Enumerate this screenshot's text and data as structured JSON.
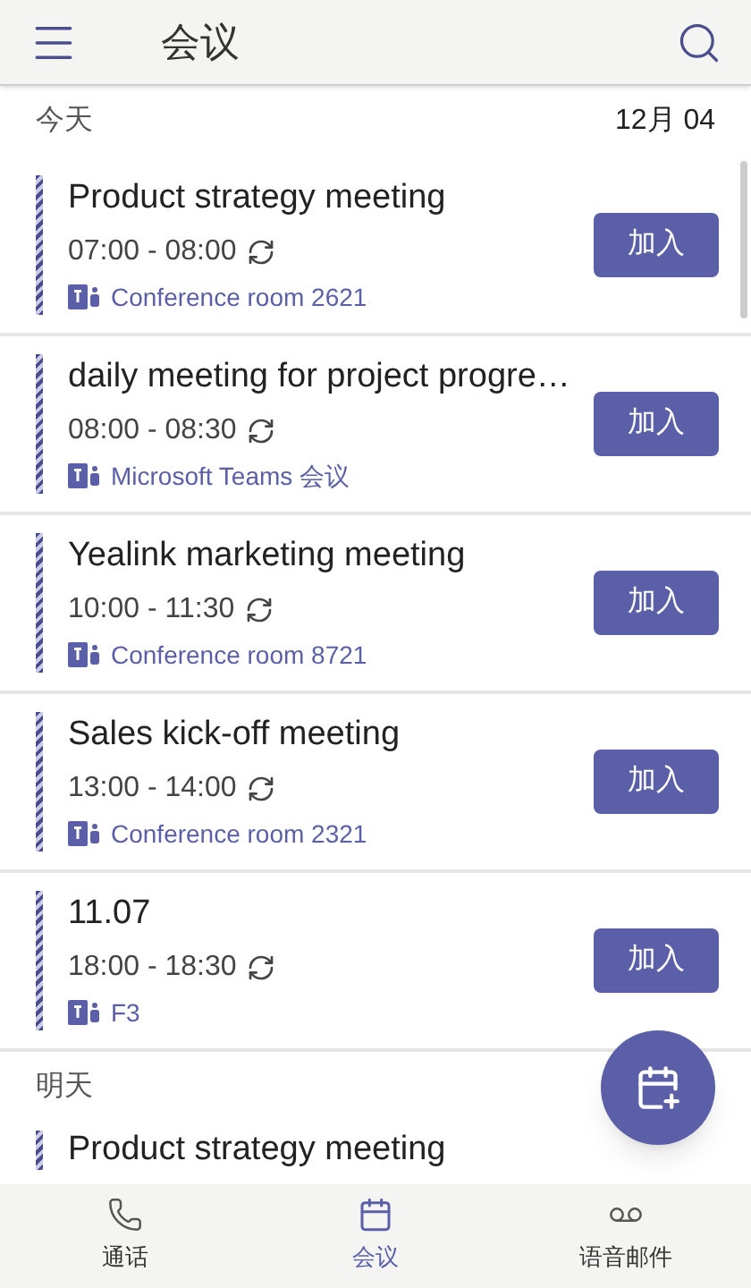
{
  "header": {
    "title": "会议"
  },
  "sections": [
    {
      "label": "今天",
      "date": "12月 04",
      "meetings": [
        {
          "title": "Product strategy meeting",
          "time": "07:00 - 08:00",
          "recurring": true,
          "location": "Conference room 2621",
          "action": "加入"
        },
        {
          "title": "daily meeting for project progre…",
          "time": "08:00 - 08:30",
          "recurring": true,
          "location": "Microsoft Teams 会议",
          "action": "加入"
        },
        {
          "title": "Yealink marketing meeting",
          "time": "10:00 - 11:30",
          "recurring": true,
          "location": "Conference room 8721",
          "action": "加入"
        },
        {
          "title": "Sales kick-off meeting",
          "time": "13:00 - 14:00",
          "recurring": true,
          "location": "Conference room 2321",
          "action": "加入"
        },
        {
          "title": "11.07",
          "time": "18:00 - 18:30",
          "recurring": true,
          "location": "F3",
          "action": "加入"
        }
      ]
    },
    {
      "label": "明天",
      "partial_title": "Product strategy meeting"
    }
  ],
  "nav": [
    {
      "kind": "calls",
      "label": "通话",
      "selected": false
    },
    {
      "kind": "meetings",
      "label": "会议",
      "selected": true
    },
    {
      "kind": "voicemail",
      "label": "语音邮件",
      "selected": false
    }
  ]
}
